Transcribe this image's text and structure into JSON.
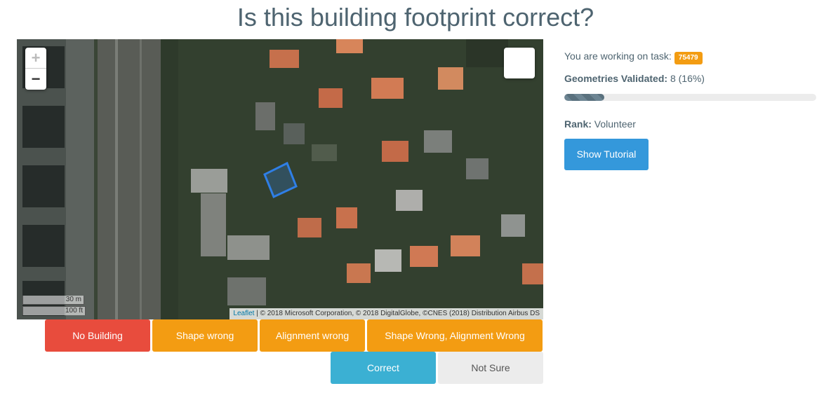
{
  "header": {
    "title": "Is this building footprint correct?"
  },
  "map": {
    "zoom_in": "+",
    "zoom_out": "−",
    "scale_metric": "30 m",
    "scale_imperial": "100 ft",
    "attribution_link": "Leaflet",
    "attribution_text": " | © 2018 Microsoft Corporation, © 2018 DigitalGlobe, ©CNES (2018) Distribution Airbus DS",
    "footprint_color": "#2f7fe6",
    "layer_icon": "layers-icon"
  },
  "actions": {
    "no_building": "No Building",
    "shape_wrong": "Shape wrong",
    "alignment_wrong": "Alignment wrong",
    "shape_alignment_wrong": "Shape Wrong, Alignment Wrong",
    "correct": "Correct",
    "not_sure": "Not Sure"
  },
  "sidebar": {
    "task_label": "You are working on task:",
    "task_id": "75479",
    "geometries_label": "Geometries Validated:",
    "geometries_value": " 8 (16%)",
    "progress_percent": 16,
    "rank_label": "Rank:",
    "rank_value": " Volunteer",
    "tutorial_button": "Show Tutorial"
  },
  "colors": {
    "title": "#4e6470",
    "no_building": "#e84c3d",
    "warning": "#f39c12",
    "correct": "#3bb0d3",
    "tutorial": "#3498db"
  }
}
